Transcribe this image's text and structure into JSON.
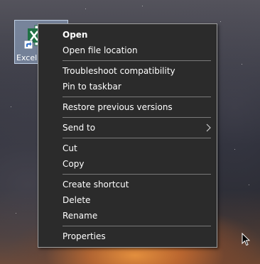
{
  "desktop": {
    "shortcut": {
      "label": "Excel",
      "icon": "excel-icon",
      "overlay_icon": "shortcut-arrow-icon"
    }
  },
  "context_menu": {
    "groups": [
      {
        "items": [
          {
            "label": "Open",
            "bold": true
          },
          {
            "label": "Open file location"
          }
        ]
      },
      {
        "items": [
          {
            "label": "Troubleshoot compatibility"
          },
          {
            "label": "Pin to taskbar"
          }
        ]
      },
      {
        "items": [
          {
            "label": "Restore previous versions"
          }
        ]
      },
      {
        "items": [
          {
            "label": "Send to",
            "submenu": true
          }
        ]
      },
      {
        "items": [
          {
            "label": "Cut"
          },
          {
            "label": "Copy"
          }
        ]
      },
      {
        "items": [
          {
            "label": "Create shortcut"
          },
          {
            "label": "Delete"
          },
          {
            "label": "Rename"
          }
        ]
      },
      {
        "items": [
          {
            "label": "Properties"
          }
        ]
      }
    ]
  },
  "colors": {
    "menu_background": "#2b2b2b",
    "menu_text": "#ffffff",
    "separator": "#7a7a7a",
    "excel_green": "#1f7145",
    "selection_highlight": "#94aaca"
  }
}
